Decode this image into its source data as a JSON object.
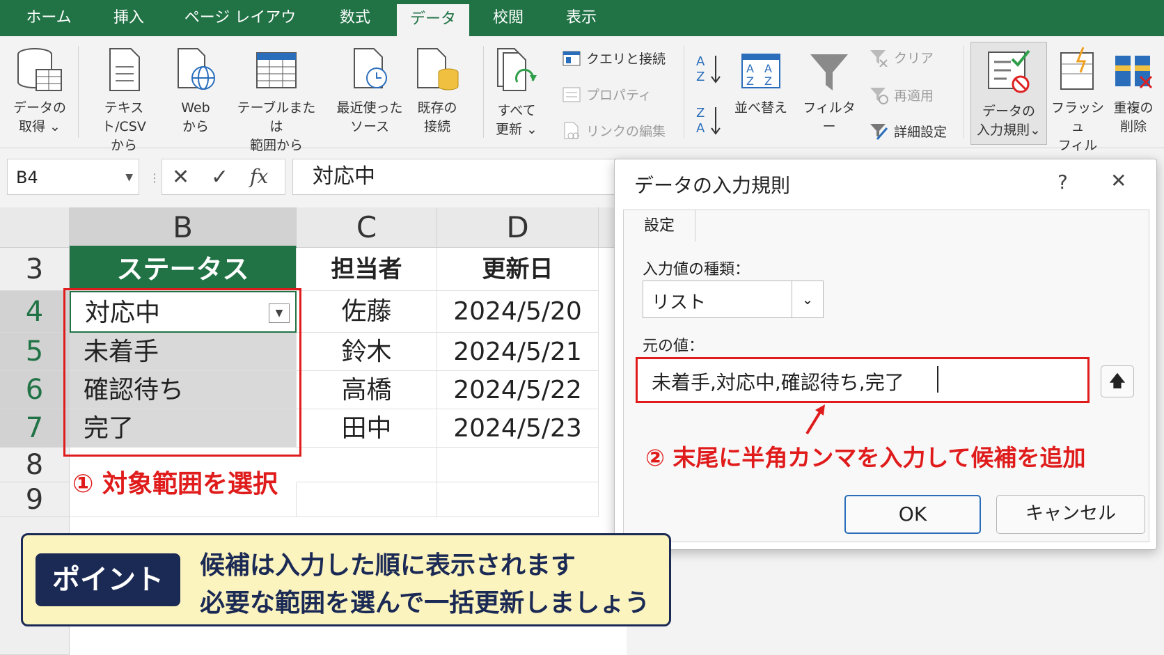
{
  "tabs": [
    "ホーム",
    "挿入",
    "ページ レイアウト",
    "数式",
    "データ",
    "校閲",
    "表示"
  ],
  "active_tab": "データ",
  "ribbon": {
    "get_data": "データの\n取得 ⌄",
    "text_csv": "テキスト/CSV\nから",
    "web": "Web\nから",
    "table_range": "テーブルまたは\n範囲から",
    "recent_sources": "最近使った\nソース",
    "existing_connections": "既存の\n接続",
    "refresh_all": "すべて\n更新 ⌄",
    "queries_connections": "クエリと接続",
    "properties": "プロパティ",
    "edit_links": "リンクの編集",
    "sort": "並べ替え",
    "filter": "フィルター",
    "clear": "クリア",
    "reapply": "再適用",
    "advanced": "詳細設定",
    "data_validation": "データの\n入力規則⌄",
    "flash_fill": "フラッシュ\nフィル",
    "remove_duplicates": "重複の\n削除"
  },
  "formula_bar": {
    "name_box": "B4",
    "fx": "fx",
    "value": "対応中"
  },
  "sheet": {
    "columns": [
      "B",
      "C",
      "D"
    ],
    "rows": [
      "3",
      "4",
      "5",
      "6",
      "7",
      "8",
      "9"
    ],
    "header": [
      "ステータス",
      "担当者",
      "更新日"
    ],
    "data": [
      [
        "対応中",
        "佐藤",
        "2024/5/20"
      ],
      [
        "未着手",
        "鈴木",
        "2024/5/21"
      ],
      [
        "確認待ち",
        "高橋",
        "2024/5/22"
      ],
      [
        "完了",
        "田中",
        "2024/5/23"
      ]
    ]
  },
  "dialog": {
    "title": "データの入力規則",
    "help": "?",
    "close": "✕",
    "tab": "設定",
    "type_label": "入力値の種類：",
    "type_value": "リスト",
    "source_label": "元の値：",
    "source_value": "未着手,対応中,確認待ち,完了",
    "ok": "OK",
    "cancel": "キャンセル"
  },
  "annotations": {
    "step1": "① 対象範囲を選択",
    "step2": "② 末尾に半角カンマを入力して候補を追加",
    "point_label": "ポイント",
    "point_line1": "候補は入力した順に表示されます",
    "point_line2": "必要な範囲を選んで一括更新しましょう"
  },
  "colors": {
    "excel_green": "#217346",
    "highlight_red": "#e01b1b",
    "point_bg": "#fcf4bf",
    "point_navy": "#1b2a55"
  }
}
